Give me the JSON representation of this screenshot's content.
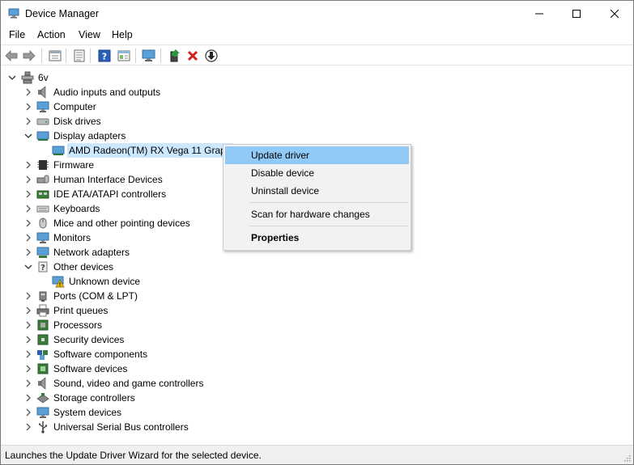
{
  "window": {
    "title": "Device Manager"
  },
  "menubar": {
    "items": [
      "File",
      "Action",
      "View",
      "Help"
    ]
  },
  "toolbar": {
    "buttons": [
      "back-icon",
      "forward-icon",
      "properties-view-icon",
      "device-list-icon",
      "help-icon",
      "console-tree-icon",
      "scan-hardware-icon",
      "update-driver-icon",
      "uninstall-device-icon",
      "disable-device-icon"
    ]
  },
  "tree": {
    "root": "6v",
    "categories": [
      {
        "label": "Audio inputs and outputs",
        "icon": "speaker-icon",
        "expanded": false
      },
      {
        "label": "Computer",
        "icon": "monitor-icon",
        "expanded": false
      },
      {
        "label": "Disk drives",
        "icon": "disk-drive-icon",
        "expanded": false
      },
      {
        "label": "Display adapters",
        "icon": "display-adapter-icon",
        "expanded": true
      },
      {
        "label": "Firmware",
        "icon": "firmware-icon",
        "expanded": false
      },
      {
        "label": "Human Interface Devices",
        "icon": "hid-icon",
        "expanded": false
      },
      {
        "label": "IDE ATA/ATAPI controllers",
        "icon": "ide-controller-icon",
        "expanded": false
      },
      {
        "label": "Keyboards",
        "icon": "keyboard-icon",
        "expanded": false
      },
      {
        "label": "Mice and other pointing devices",
        "icon": "mouse-icon",
        "expanded": false
      },
      {
        "label": "Monitors",
        "icon": "monitor-icon",
        "expanded": false
      },
      {
        "label": "Network adapters",
        "icon": "network-adapter-icon",
        "expanded": false
      },
      {
        "label": "Other devices",
        "icon": "other-devices-icon",
        "expanded": true
      },
      {
        "label": "Ports (COM & LPT)",
        "icon": "port-icon",
        "expanded": false
      },
      {
        "label": "Print queues",
        "icon": "printer-icon",
        "expanded": false
      },
      {
        "label": "Processors",
        "icon": "processor-icon",
        "expanded": false
      },
      {
        "label": "Security devices",
        "icon": "security-device-icon",
        "expanded": false
      },
      {
        "label": "Software components",
        "icon": "software-component-icon",
        "expanded": false
      },
      {
        "label": "Software devices",
        "icon": "software-device-icon",
        "expanded": false
      },
      {
        "label": "Sound, video and game controllers",
        "icon": "speaker-icon",
        "expanded": false
      },
      {
        "label": "Storage controllers",
        "icon": "storage-controller-icon",
        "expanded": false
      },
      {
        "label": "System devices",
        "icon": "system-device-icon",
        "expanded": false
      },
      {
        "label": "Universal Serial Bus controllers",
        "icon": "usb-icon",
        "expanded": false
      }
    ],
    "display_child": "AMD Radeon(TM) RX Vega 11 Graph",
    "other_child": "Unknown device"
  },
  "context_menu": {
    "items": [
      {
        "label": "Update driver",
        "highlighted": true
      },
      {
        "label": "Disable device"
      },
      {
        "label": "Uninstall device"
      },
      {
        "label": "Scan for hardware changes"
      },
      {
        "label": "Properties",
        "bold": true
      }
    ]
  },
  "statusbar": {
    "text": "Launches the Update Driver Wizard for the selected device."
  },
  "colors": {
    "selection": "#cce8ff",
    "menu_highlight": "#91c9f7",
    "accent_blue": "#1e78d2",
    "delete_red": "#d81e1e",
    "driver_green": "#2c9a3a"
  }
}
